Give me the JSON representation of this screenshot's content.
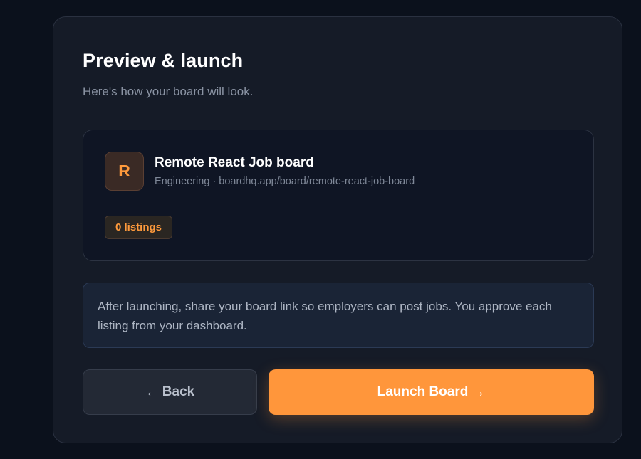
{
  "page": {
    "title": "Preview & launch",
    "subtitle": "Here's how your board will look."
  },
  "preview": {
    "avatar_letter": "R",
    "board_name": "Remote React Job board",
    "board_meta": "Engineering · boardhq.app/board/remote-react-job-board",
    "listings_badge": "0 listings"
  },
  "info": {
    "text": "After launching, share your board link so employers can post jobs. You approve each listing from your dashboard."
  },
  "actions": {
    "back_arrow": "←",
    "back_label": "Back",
    "launch_label": "Launch Board",
    "launch_arrow": "→"
  },
  "colors": {
    "accent": "#ff963b",
    "background": "#0b111c",
    "card": "#151b27"
  }
}
